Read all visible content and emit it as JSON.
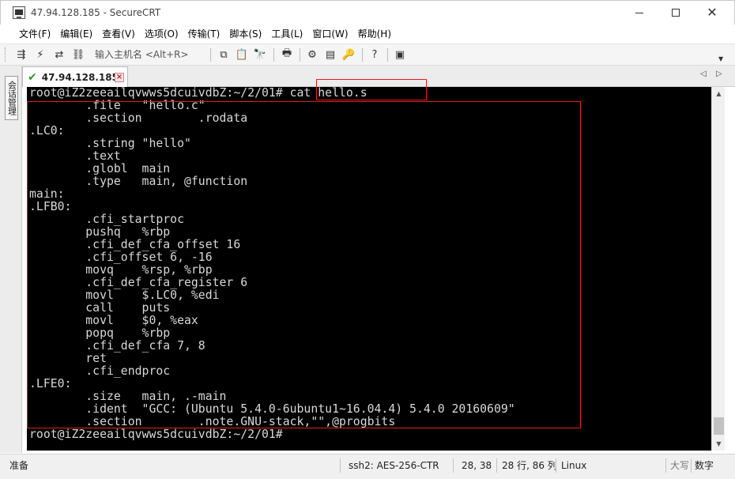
{
  "window": {
    "title": "47.94.128.185 - SecureCRT"
  },
  "menu": {
    "items": [
      "文件(F)",
      "编辑(E)",
      "查看(V)",
      "选项(O)",
      "传输(T)",
      "脚本(S)",
      "工具(L)",
      "窗口(W)",
      "帮助(H)"
    ]
  },
  "toolbar": {
    "host_placeholder": "输入主机名 <Alt+R>"
  },
  "side_panel": {
    "label": "会话管理"
  },
  "tab": {
    "label": "47.94.128.185"
  },
  "terminal": {
    "lines": [
      "root@iZ2zeeailqvwws5dcuivdbZ:~/2/01# cat hello.s",
      "        .file   \"hello.c\"",
      "        .section        .rodata",
      ".LC0:",
      "        .string \"hello\"",
      "        .text",
      "        .globl  main",
      "        .type   main, @function",
      "main:",
      ".LFB0:",
      "        .cfi_startproc",
      "        pushq   %rbp",
      "        .cfi_def_cfa_offset 16",
      "        .cfi_offset 6, -16",
      "        movq    %rsp, %rbp",
      "        .cfi_def_cfa_register 6",
      "        movl    $.LC0, %edi",
      "        call    puts",
      "        movl    $0, %eax",
      "        popq    %rbp",
      "        .cfi_def_cfa 7, 8",
      "        ret",
      "        .cfi_endproc",
      ".LFE0:",
      "        .size   main, .-main",
      "        .ident  \"GCC: (Ubuntu 5.4.0-6ubuntu1~16.04.4) 5.4.0 20160609\"",
      "        .section        .note.GNU-stack,\"\",@progbits",
      "root@iZ2zeeailqvwws5dcuivdbZ:~/2/01# "
    ]
  },
  "status": {
    "ready": "准备",
    "cipher": "ssh2: AES-256-CTR",
    "cursor": "28,  38",
    "size": "28 行, 86 列",
    "term_type": "Linux",
    "caps": "大写",
    "num": "数字"
  },
  "colors": {
    "highlight": "#e02020",
    "terminal_bg": "#000000",
    "terminal_fg": "#d8d8d8",
    "tab_check": "#2a9d2a"
  }
}
